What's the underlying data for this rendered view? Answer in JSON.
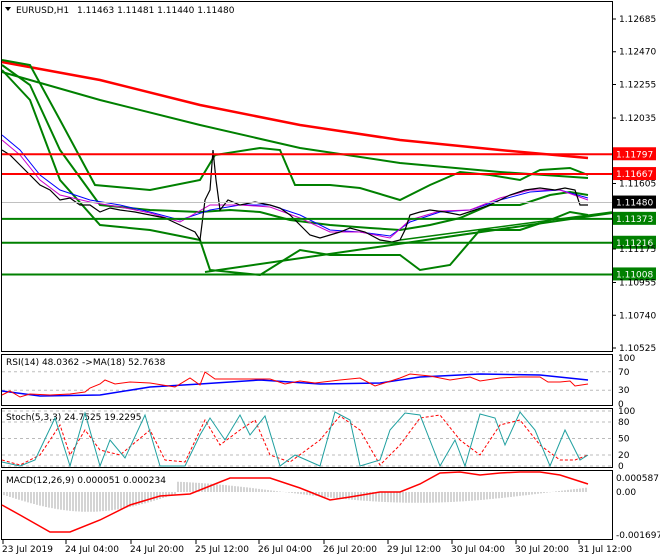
{
  "header": {
    "symbol": "EURUSD,H1",
    "ohlc": "1.11463 1.11481 1.11440 1.11480"
  },
  "price_axis": [
    "1.12685",
    "1.12470",
    "1.12255",
    "1.12035",
    "1.11605",
    "1.11175",
    "1.10955",
    "1.10740",
    "1.10525"
  ],
  "levels": [
    {
      "value": "1.11797",
      "color": "#ff0000"
    },
    {
      "value": "1.11667",
      "color": "#ff0000"
    },
    {
      "value": "1.11480",
      "color": "#000000"
    },
    {
      "value": "1.11373",
      "color": "#008000"
    },
    {
      "value": "1.11216",
      "color": "#008000"
    },
    {
      "value": "1.11008",
      "color": "#008000"
    }
  ],
  "rsi": {
    "label": "RSI(14) 48.0362  ->MA(18) 52.7638",
    "axis": [
      "100",
      "70",
      "30",
      "0"
    ]
  },
  "stoch": {
    "label": "Stoch(5,3,3) 24.7525 19.2295",
    "axis": [
      "100",
      "80",
      "50",
      "20",
      "0"
    ]
  },
  "macd": {
    "label": "MACD(12,26,9) 0.000051 0.000234",
    "axis": [
      "0.000587",
      "0.00",
      "-0.001697"
    ]
  },
  "time_axis": [
    "23 Jul 2019",
    "24 Jul 04:00",
    "24 Jul 20:00",
    "25 Jul 12:00",
    "26 Jul 04:00",
    "26 Jul 20:00",
    "29 Jul 12:00",
    "30 Jul 04:00",
    "30 Jul 20:00",
    "31 Jul 12:00"
  ]
}
